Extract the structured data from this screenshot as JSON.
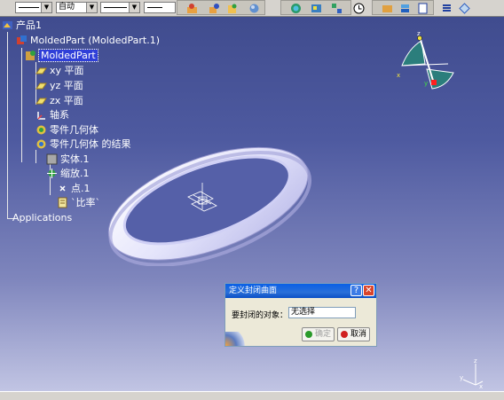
{
  "toolbar": {
    "line_style_value": "",
    "color_value": "自动",
    "line_weight_value": "",
    "line_type_value": ""
  },
  "tree": {
    "root": "产品1",
    "part": "MoldedPart (MoldedPart.1)",
    "part_body_selected": "MoldedPart",
    "xy_plane": "xy 平面",
    "yz_plane": "yz 平面",
    "zx_plane": "zx 平面",
    "axis_system": "轴系",
    "geometric_set": "零件几何体",
    "geometric_set_result": "零件几何体 的结果",
    "solid": "实体.1",
    "scaling": "缩放.1",
    "point": "点.1",
    "ratio": "`比率`",
    "applications": "Applications"
  },
  "dialog": {
    "title": "定义封闭曲面",
    "field_label": "要封闭的对象：",
    "field_value": "无选择",
    "ok_label": "确定",
    "cancel_label": "取消"
  },
  "compass": {
    "x_label": "x",
    "y_label": "y",
    "z_label": "z"
  },
  "axis_small": {
    "x_label": "x",
    "y_label": "y",
    "z_label": "z"
  }
}
